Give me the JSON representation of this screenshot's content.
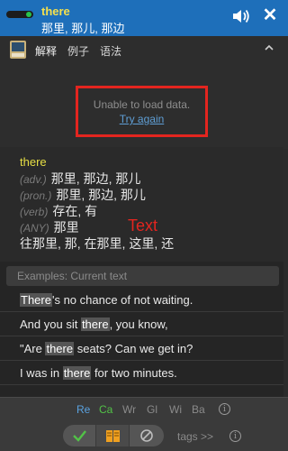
{
  "header": {
    "word": "there",
    "translation": "那里, 那儿, 那边",
    "bg_color": "#1e6fba"
  },
  "tabs": [
    {
      "label": "解释",
      "active": true
    },
    {
      "label": "例子",
      "active": false
    },
    {
      "label": "语法",
      "active": false
    }
  ],
  "error": {
    "message": "Unable to load data.",
    "retry": "Try again"
  },
  "definition": {
    "word": "there",
    "entries": [
      {
        "pos": "(adv.)",
        "text": "那里, 那边, 那儿"
      },
      {
        "pos": "(pron.)",
        "text": "那里, 那边, 那儿"
      },
      {
        "pos": "(verb)",
        "text": "存在, 有"
      },
      {
        "pos": "(ANY)",
        "text": "那里"
      }
    ],
    "extra": "往那里, 那, 在那里, 这里, 还",
    "annotation": "Text"
  },
  "examples": {
    "header": "Examples: Current text",
    "rows": [
      {
        "before": "",
        "hl": "There",
        "after": "'s no chance of not waiting."
      },
      {
        "before": "And you sit ",
        "hl": "there",
        "after": ", you know,"
      },
      {
        "before": "\"Are ",
        "hl": "there",
        "after": " seats? Can we get in?"
      },
      {
        "before": "I was in ",
        "hl": "there",
        "after": " for two minutes."
      }
    ]
  },
  "dictionaries": [
    "Re",
    "Ca",
    "Wr",
    "Gl",
    "Wi",
    "Ba"
  ],
  "actions": {
    "tags": "tags >>"
  },
  "icons": {
    "speaker": "speaker-icon",
    "close": "close-icon",
    "chevron": "chevron-up-icon",
    "check": "check-icon",
    "book": "book-icon",
    "ban": "ban-icon",
    "info": "info-icon"
  }
}
